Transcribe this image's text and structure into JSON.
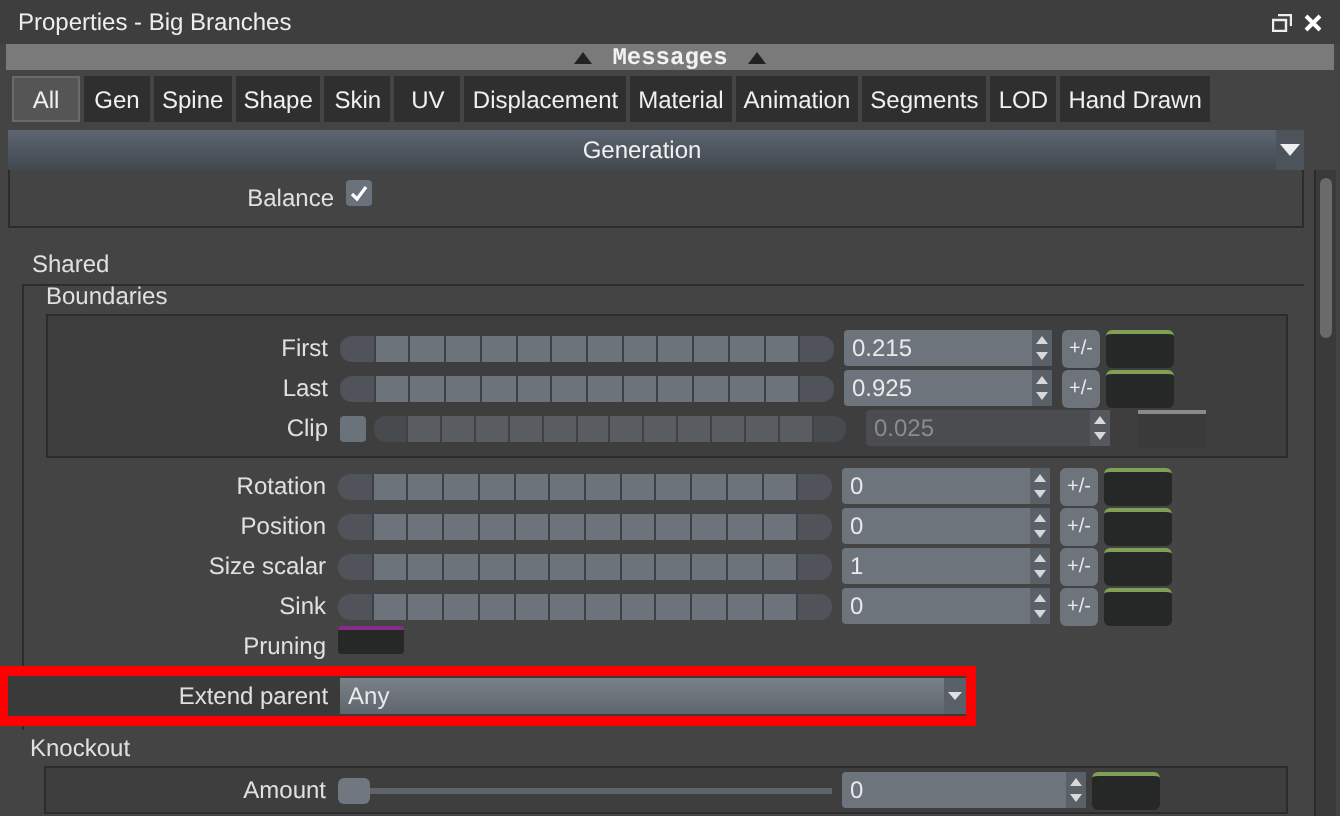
{
  "window": {
    "title": "Properties - Big Branches"
  },
  "messages_bar": {
    "label": "Messages"
  },
  "tabs": [
    {
      "label": "All",
      "selected": true
    },
    {
      "label": "Gen",
      "selected": false
    },
    {
      "label": "Spine",
      "selected": false
    },
    {
      "label": "Shape",
      "selected": false
    },
    {
      "label": "Skin",
      "selected": false
    },
    {
      "label": "UV",
      "selected": false
    },
    {
      "label": "Displacement",
      "selected": false
    },
    {
      "label": "Material",
      "selected": false
    },
    {
      "label": "Animation",
      "selected": false
    },
    {
      "label": "Segments",
      "selected": false
    },
    {
      "label": "LOD",
      "selected": false
    },
    {
      "label": "Hand Drawn",
      "selected": false
    }
  ],
  "section": {
    "title": "Generation"
  },
  "balance": {
    "label": "Balance",
    "checked": true
  },
  "shared": {
    "title": "Shared",
    "boundaries": {
      "title": "Boundaries",
      "rows": [
        {
          "kind": "slider",
          "label": "First",
          "value": "0.215",
          "disabled": false,
          "color": "#7fa055"
        },
        {
          "kind": "slider",
          "label": "Last",
          "value": "0.925",
          "disabled": false,
          "color": "#7fa055"
        },
        {
          "kind": "slider",
          "label": "Clip",
          "value": "0.025",
          "checked": false,
          "disabled": true,
          "color": "#8a8a8a"
        }
      ]
    },
    "rows": [
      {
        "kind": "slider",
        "label": "Rotation",
        "value": "0",
        "disabled": false,
        "color": "#7fa055"
      },
      {
        "kind": "slider",
        "label": "Position",
        "value": "0",
        "disabled": false,
        "color": "#7fa055"
      },
      {
        "kind": "slider",
        "label": "Size scalar",
        "value": "1",
        "disabled": false,
        "color": "#7fa055"
      },
      {
        "kind": "slider",
        "label": "Sink",
        "value": "0",
        "disabled": false,
        "color": "#7fa055"
      },
      {
        "kind": "swatch",
        "label": "Pruning",
        "color": "#8a2a8a"
      },
      {
        "kind": "dropdown",
        "label": "Extend parent",
        "value": "Any",
        "highlighted": true
      }
    ]
  },
  "knockout": {
    "title": "Knockout",
    "rows": [
      {
        "kind": "plain_slider",
        "label": "Amount",
        "value": "0",
        "level": 0,
        "color": "#7fa055"
      }
    ]
  },
  "pm_label": "+/-"
}
